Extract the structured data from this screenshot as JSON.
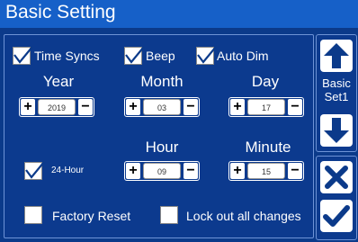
{
  "title": "Basic Setting",
  "options": {
    "time_syncs": {
      "label": "Time Syncs",
      "checked": true
    },
    "beep": {
      "label": "Beep",
      "checked": true
    },
    "auto_dim": {
      "label": "Auto Dim",
      "checked": true
    },
    "hour24": {
      "label": "24-Hour",
      "checked": true
    },
    "factory_reset": {
      "label": "Factory Reset",
      "checked": false
    },
    "lockout": {
      "label": "Lock out all changes",
      "checked": false
    }
  },
  "date": {
    "year": {
      "label": "Year",
      "value": "2019"
    },
    "month": {
      "label": "Month",
      "value": "03"
    },
    "day": {
      "label": "Day",
      "value": "17"
    }
  },
  "time": {
    "hour": {
      "label": "Hour",
      "value": "09"
    },
    "minute": {
      "label": "Minute",
      "value": "15"
    }
  },
  "stepper": {
    "plus": "+",
    "minus": "−"
  },
  "side": {
    "page_line1": "Basic",
    "page_line2": "Set1",
    "up_icon": "arrow-up-icon",
    "down_icon": "arrow-down-icon",
    "cancel_icon": "x-icon",
    "confirm_icon": "checkmark-icon"
  }
}
